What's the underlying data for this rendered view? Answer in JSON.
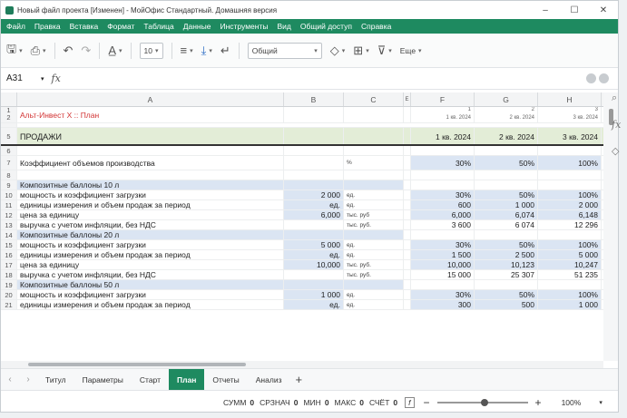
{
  "window": {
    "title": "Новый файл проекта [Изменен] - МойОфис Стандартный. Домашняя версия",
    "minimize": "–",
    "maximize": "☐",
    "close": "✕"
  },
  "menu": [
    "Файл",
    "Правка",
    "Вставка",
    "Формат",
    "Таблица",
    "Данные",
    "Инструменты",
    "Вид",
    "Общий доступ",
    "Справка"
  ],
  "toolbar": {
    "font_size": "10",
    "number_format": "Общий",
    "more": "Еще"
  },
  "formula": {
    "cell_ref": "A31",
    "fx": "fx",
    "value": ""
  },
  "columns": [
    "A",
    "B",
    "C",
    "E",
    "F",
    "G",
    "H"
  ],
  "sheet": {
    "title": "Альт-Инвест X :: План",
    "period_nums": [
      "1",
      "2",
      "3"
    ],
    "period_small": [
      "1 кв. 2024",
      "2 кв. 2024",
      "3 кв. 2024"
    ],
    "sales_label": "ПРОДАЖИ",
    "periods": [
      "1 кв. 2024",
      "2 кв. 2024",
      "3 кв. 2024"
    ],
    "rows": [
      {
        "n": "6",
        "a": "",
        "b": "",
        "c": "",
        "f": "",
        "g": "",
        "h": "",
        "type": "empty"
      },
      {
        "n": "7",
        "a": "Коэффициент объемов производства",
        "b": "",
        "c": "%",
        "f": "30%",
        "g": "50%",
        "h": "100%",
        "type": "coef"
      },
      {
        "n": "8",
        "a": "",
        "b": "",
        "c": "",
        "f": "",
        "g": "",
        "h": "",
        "type": "empty"
      },
      {
        "n": "9",
        "a": "Композитные баллоны 10 л",
        "b": "",
        "c": "",
        "f": "",
        "g": "",
        "h": "",
        "type": "section"
      },
      {
        "n": "10",
        "a": "  мощность и коэффициент загрузки",
        "b": "2 000",
        "c": "ед.",
        "f": "30%",
        "g": "50%",
        "h": "100%",
        "type": "input"
      },
      {
        "n": "11",
        "a": "  единицы измерения и объем продаж за период",
        "b": "ед.",
        "c": "ед.",
        "f": "600",
        "g": "1 000",
        "h": "2 000",
        "type": "input"
      },
      {
        "n": "12",
        "a": "  цена за единицу",
        "b": "6,000",
        "c": "тыс. руб",
        "f": "6,000",
        "g": "6,074",
        "h": "6,148",
        "type": "input"
      },
      {
        "n": "13",
        "a": "  выручка с учетом инфляции, без НДС",
        "b": "",
        "c": "тыс. руб.",
        "f": "3 600",
        "g": "6 074",
        "h": "12 296",
        "type": "plain"
      },
      {
        "n": "14",
        "a": "Композитные баллоны 20 л",
        "b": "",
        "c": "",
        "f": "",
        "g": "",
        "h": "",
        "type": "section"
      },
      {
        "n": "15",
        "a": "  мощность и коэффициент загрузки",
        "b": "5 000",
        "c": "ед.",
        "f": "30%",
        "g": "50%",
        "h": "100%",
        "type": "input"
      },
      {
        "n": "16",
        "a": "  единицы измерения и объем продаж за период",
        "b": "ед.",
        "c": "ед.",
        "f": "1 500",
        "g": "2 500",
        "h": "5 000",
        "type": "input"
      },
      {
        "n": "17",
        "a": "  цена за единицу",
        "b": "10,000",
        "c": "тыс. руб.",
        "f": "10,000",
        "g": "10,123",
        "h": "10,247",
        "type": "input"
      },
      {
        "n": "18",
        "a": "  выручка с учетом инфляции, без НДС",
        "b": "",
        "c": "тыс. руб.",
        "f": "15 000",
        "g": "25 307",
        "h": "51 235",
        "type": "plain"
      },
      {
        "n": "19",
        "a": "Композитные баллоны 50 л",
        "b": "",
        "c": "",
        "f": "",
        "g": "",
        "h": "",
        "type": "section"
      },
      {
        "n": "20",
        "a": "  мощность и коэффициент загрузки",
        "b": "1 000",
        "c": "ед.",
        "f": "30%",
        "g": "50%",
        "h": "100%",
        "type": "input"
      },
      {
        "n": "21",
        "a": "  единицы измерения и объем продаж за период",
        "b": "ед.",
        "c": "ед.",
        "f": "300",
        "g": "500",
        "h": "1 000",
        "type": "input"
      }
    ]
  },
  "tabs": [
    "Титул",
    "Параметры",
    "Старт",
    "План",
    "Отчеты",
    "Анализ"
  ],
  "active_tab": "План",
  "status": {
    "sum_label": "СУММ",
    "sum": "0",
    "avg_label": "СРЗНАЧ",
    "avg": "0",
    "min_label": "МИН",
    "min": "0",
    "max_label": "МАКС",
    "max": "0",
    "count_label": "СЧЁТ",
    "count": "0",
    "zoom": "100%"
  },
  "colors": {
    "accent": "#1e8a60",
    "input_fill": "#dbe5f3",
    "sales_fill": "#e3edd7",
    "title_red": "#d23333"
  }
}
